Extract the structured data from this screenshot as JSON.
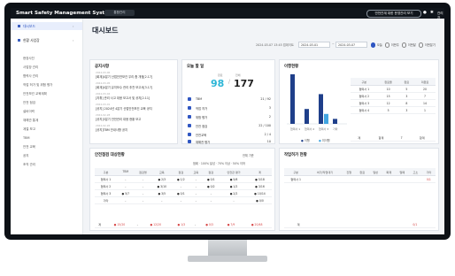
{
  "app": {
    "title": "Smart Safety Management System",
    "badge": "통합관리",
    "top_button": "안전관계 대한 운영관리 보기",
    "user": "관리자"
  },
  "sidebar": {
    "items": [
      {
        "label": "대시보드"
      },
      {
        "label": "현황 사업장"
      }
    ],
    "sub_items": [
      "현장사진",
      "사업장 관리",
      "협력사 관리",
      "작업 허가 및 위험 평가",
      "안전보건 교육계획",
      "안전 점검",
      "설비이력",
      "재해관 통계",
      "계절 보고",
      "TBM",
      "안전 교육",
      "공지",
      "조직 관리"
    ]
  },
  "main": {
    "title": "대시보드",
    "updated": "2024-03-07 13:45 업데이트",
    "date_from": "2024-03-01",
    "date_to": "2024-03-07",
    "period_options": [
      {
        "label": "오늘",
        "on": true
      },
      {
        "label": "이번주",
        "on": false
      },
      {
        "label": "이번달",
        "on": false
      },
      {
        "label": "이번분기",
        "on": false
      },
      {
        "label": "이번해",
        "on": false
      }
    ]
  },
  "notices": {
    "title": "공지사항",
    "items": [
      {
        "text": "[회계]4분기 산업안전보건 우리 좀 개정[2.17]",
        "date": "2024-03-06"
      },
      {
        "text": "[회계]4분기 유지보수 관리 추천 보고서[3.17]",
        "date": "2024-03-05"
      },
      {
        "text": "[지휘] 관리 사고 대응 보고서 및 공지[2.11]",
        "date": "2024-03-04"
      },
      {
        "text": "[공지] 2024년 4분기 산업안전보건 교육 공지",
        "date": "2024-03-01"
      },
      {
        "text": "[공지]3분기 안전관리 대응 현황 보고",
        "date": "2024-02-28"
      },
      {
        "text": "[공지]TBM 안내사항 공지",
        "date": "2024-02-26"
      }
    ]
  },
  "today": {
    "title": "오늘 할 일",
    "labels": [
      "완료",
      "전체"
    ],
    "done": "98",
    "total": "177",
    "rows": [
      {
        "label": "TBM",
        "value": "21 / 92"
      },
      {
        "label": "작업 허가",
        "value": "3"
      },
      {
        "label": "위험 평가",
        "value": "2"
      },
      {
        "label": "안전 점검",
        "value": "22 / 100"
      },
      {
        "label": "안전교육",
        "value": "2 / 4"
      },
      {
        "label": "재해관 평가",
        "value": "10"
      }
    ]
  },
  "chart_panel": {
    "title": "이행현황",
    "legend": [
      "이행",
      "미이행"
    ],
    "colors": {
      "primary": "#1f3f8a",
      "secondary": "#42a5e0"
    },
    "table": {
      "headers": [
        "구분",
        "완료율",
        "완료",
        "미완료"
      ],
      "rows": [
        [
          "협력사 1",
          "10",
          "5",
          "20"
        ],
        [
          "협력사 2",
          "15",
          "3",
          "7"
        ],
        [
          "협력사 3",
          "12",
          "8",
          "14"
        ],
        [
          "협력사 4",
          "5",
          "3",
          "1"
        ]
      ],
      "total": [
        "계",
        "합계",
        "7",
        "합계"
      ]
    }
  },
  "chart_data": {
    "type": "bar",
    "categories": [
      "협력사 1",
      "협력사 2",
      "협력사 3",
      "기타"
    ],
    "series": [
      {
        "name": "이행",
        "values": [
          100,
          30,
          60,
          10
        ]
      },
      {
        "name": "미이행",
        "values": [
          0,
          0,
          20,
          0
        ]
      }
    ]
  },
  "safety_log": {
    "title": "안전점검 대상현황",
    "filter": "전체 기준",
    "legend_note": "범례 · 100% 달성 · 70% 이상 · 50% 이하",
    "headers": [
      "구분",
      "TBM",
      "점검명",
      "교육",
      "점검",
      "교육",
      "점검",
      "안전관 평가",
      "계"
    ],
    "rows": [
      [
        "협력사 1",
        "-",
        "-",
        "● 2/3",
        "● 1/2",
        "-",
        "● 0/1",
        "● 5/6",
        "● 5/18"
      ],
      [
        "협력사 2",
        "-",
        "-",
        "● 3/10",
        "-",
        "-",
        "● 0/2",
        "● 1/2",
        "● 3/16"
      ],
      [
        "협력사 3",
        "● 5/7",
        "-",
        "● 3/5",
        "● 0/1",
        "-",
        "-",
        "● 2/2",
        "● 10/14"
      ],
      [
        "기타",
        "-",
        "-",
        "-",
        "-",
        "-",
        "-",
        "-",
        "● 0/0"
      ]
    ],
    "total": [
      "계",
      "● 15/20",
      "-",
      "● 12/20",
      "● 1/3",
      "-",
      "● 0/3",
      "● 7/9",
      "● 20/48"
    ]
  },
  "work_log": {
    "title": "작업허가 현황",
    "headers": [
      "구분",
      "허가/작업대기",
      "진행",
      "완료",
      "일반",
      "화재",
      "밀폐",
      "고소",
      "기타"
    ],
    "rows": [
      [
        "협력사 1",
        "",
        "",
        "",
        "",
        "",
        "",
        "",
        "0/1"
      ]
    ],
    "total": [
      "계",
      "",
      "",
      "",
      "",
      "",
      "",
      "",
      "0/1"
    ]
  }
}
